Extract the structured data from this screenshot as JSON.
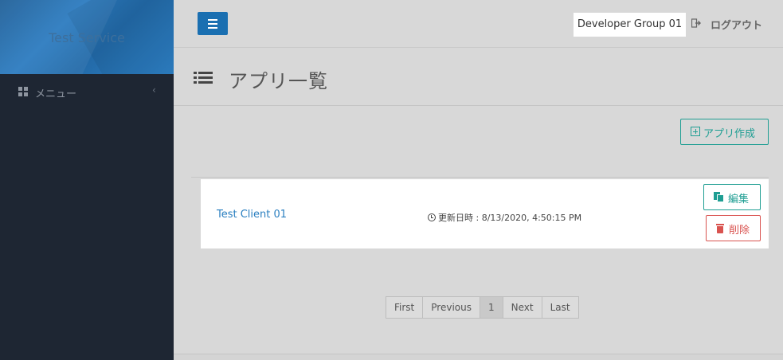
{
  "sidebar": {
    "brand_title": "Test Service",
    "menu_label": "メニュー",
    "menu_chevron": "‹"
  },
  "header": {
    "user_group": "Developer Group 01",
    "logout_label": "ログアウト"
  },
  "page": {
    "title": "アプリ一覧",
    "create_button": "アプリ作成"
  },
  "apps": [
    {
      "name": "Test Client 01",
      "updated_label": "更新日時 : 8/13/2020, 4:50:15 PM",
      "edit_label": "編集",
      "delete_label": "削除"
    }
  ],
  "pagination": {
    "first": "First",
    "previous": "Previous",
    "current": "1",
    "next": "Next",
    "last": "Last"
  },
  "colors": {
    "sidebar_bg": "#1e2633",
    "brand_blue": "#1a6fb1",
    "teal": "#1f9e93",
    "danger": "#d9534f",
    "link": "#2a7fc0"
  },
  "icons": [
    "grid-icon",
    "chevron-left-icon",
    "hamburger-icon",
    "logout-icon",
    "list-icon",
    "plus-square-icon",
    "clock-icon",
    "copy-icon",
    "trash-icon"
  ]
}
